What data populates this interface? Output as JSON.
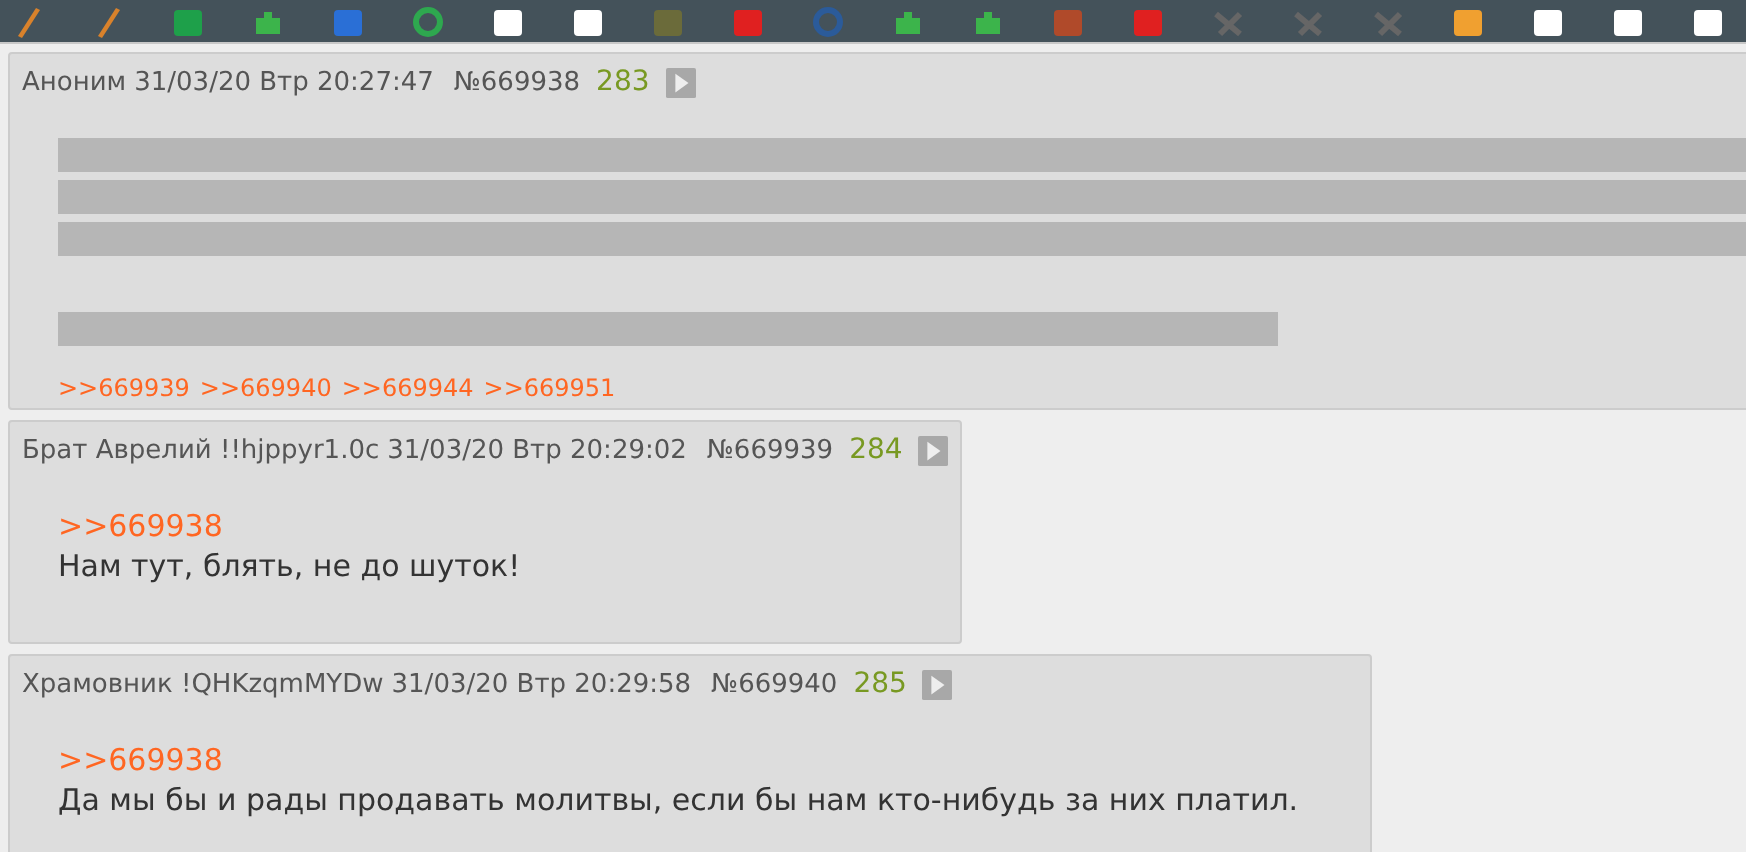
{
  "posts": [
    {
      "author": "Аноним",
      "date": "31/03/20 Втр 20:27:47",
      "number": "№669938",
      "ordinal": "283",
      "redacted": true,
      "replies": [
        ">>669939",
        ">>669940",
        ">>669944",
        ">>669951"
      ]
    },
    {
      "author": "Брат Аврелий !!hjppyr1.0c",
      "date": "31/03/20 Втр 20:29:02",
      "number": "№669939",
      "ordinal": "284",
      "quote": ">>669938",
      "text": "Нам тут, блять, не до шуток!"
    },
    {
      "author": "Храмовник !QHKzqmMYDw",
      "date": "31/03/20 Втр 20:29:58",
      "number": "№669940",
      "ordinal": "285",
      "quote": ">>669938",
      "text": "Да мы бы и рады продавать молитвы, если бы нам кто-нибудь за них платил."
    }
  ]
}
